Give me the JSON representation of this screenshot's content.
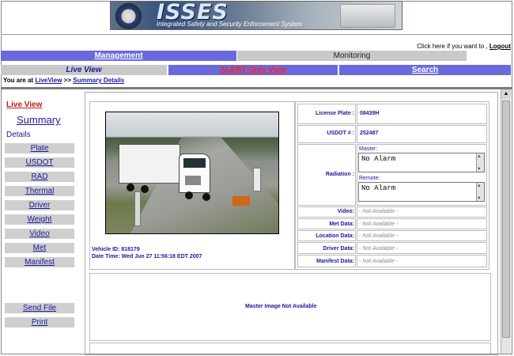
{
  "banner": {
    "title": "ISSES",
    "subtitle": "Integrated Safety and Security Enforcement System"
  },
  "header": {
    "logout_prompt": "Click here if you want to ,",
    "logout_label": "Logout"
  },
  "tabs": {
    "management": "Management",
    "monitoring": "Monitoring"
  },
  "subtabs": {
    "live_view": "Live View",
    "alert_only": "ALERT Only View",
    "search": "Search"
  },
  "breadcrumb": {
    "prefix": "You are at",
    "live_view": "LiveView",
    "separator": ">>",
    "current": "Summary Details"
  },
  "sidebar": {
    "live_view": "Live View",
    "summary": "Summary",
    "details": "Details",
    "items": [
      "Plate",
      "USDOT",
      "RAD",
      "Thermal",
      "Driver",
      "Weight",
      "Video",
      "Met",
      "Manifest"
    ],
    "send_file": "Send File",
    "print": "Print"
  },
  "vehicle": {
    "id_label": "Vehicle ID: 818179",
    "datetime_label": "Date Time: Wed Jun 27 11:56:18 EDT 2007"
  },
  "info": {
    "license_plate_label": "License Plate :",
    "license_plate_value": "08439H",
    "usdot_label": "USDOT # :",
    "usdot_value": "252487",
    "radiation_label": "Radiation :",
    "master_label": "Master:",
    "master_value": "No Alarm",
    "remote_label": "Remote:",
    "remote_value": "No Alarm",
    "video_label": "Video:",
    "met_label": "Met Data:",
    "location_label": "Location Data:",
    "driver_label": "Driver Data:",
    "manifest_label": "Manifest Data:",
    "not_available": "- Not Available -"
  },
  "master_image": {
    "text": "Master Image Not Available"
  },
  "colors": {
    "tab_blue": "#6a6adc",
    "tab_gray": "#c9c9c9",
    "link_blue": "#1a1a9a",
    "alert_red": "#ff2020"
  }
}
